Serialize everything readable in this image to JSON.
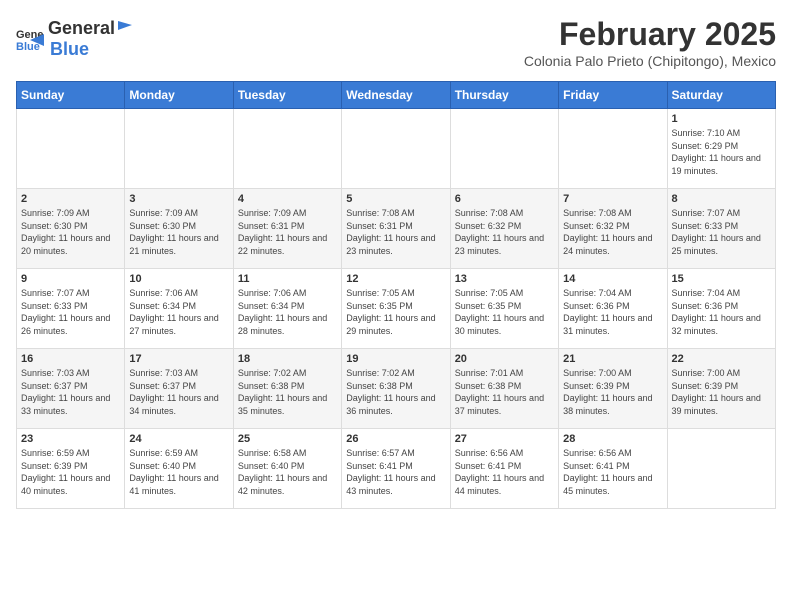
{
  "logo": {
    "general": "General",
    "blue": "Blue"
  },
  "title": "February 2025",
  "subtitle": "Colonia Palo Prieto (Chipitongo), Mexico",
  "days_of_week": [
    "Sunday",
    "Monday",
    "Tuesday",
    "Wednesday",
    "Thursday",
    "Friday",
    "Saturday"
  ],
  "weeks": [
    [
      {
        "day": "",
        "info": ""
      },
      {
        "day": "",
        "info": ""
      },
      {
        "day": "",
        "info": ""
      },
      {
        "day": "",
        "info": ""
      },
      {
        "day": "",
        "info": ""
      },
      {
        "day": "",
        "info": ""
      },
      {
        "day": "1",
        "info": "Sunrise: 7:10 AM\nSunset: 6:29 PM\nDaylight: 11 hours and 19 minutes."
      }
    ],
    [
      {
        "day": "2",
        "info": "Sunrise: 7:09 AM\nSunset: 6:30 PM\nDaylight: 11 hours and 20 minutes."
      },
      {
        "day": "3",
        "info": "Sunrise: 7:09 AM\nSunset: 6:30 PM\nDaylight: 11 hours and 21 minutes."
      },
      {
        "day": "4",
        "info": "Sunrise: 7:09 AM\nSunset: 6:31 PM\nDaylight: 11 hours and 22 minutes."
      },
      {
        "day": "5",
        "info": "Sunrise: 7:08 AM\nSunset: 6:31 PM\nDaylight: 11 hours and 23 minutes."
      },
      {
        "day": "6",
        "info": "Sunrise: 7:08 AM\nSunset: 6:32 PM\nDaylight: 11 hours and 23 minutes."
      },
      {
        "day": "7",
        "info": "Sunrise: 7:08 AM\nSunset: 6:32 PM\nDaylight: 11 hours and 24 minutes."
      },
      {
        "day": "8",
        "info": "Sunrise: 7:07 AM\nSunset: 6:33 PM\nDaylight: 11 hours and 25 minutes."
      }
    ],
    [
      {
        "day": "9",
        "info": "Sunrise: 7:07 AM\nSunset: 6:33 PM\nDaylight: 11 hours and 26 minutes."
      },
      {
        "day": "10",
        "info": "Sunrise: 7:06 AM\nSunset: 6:34 PM\nDaylight: 11 hours and 27 minutes."
      },
      {
        "day": "11",
        "info": "Sunrise: 7:06 AM\nSunset: 6:34 PM\nDaylight: 11 hours and 28 minutes."
      },
      {
        "day": "12",
        "info": "Sunrise: 7:05 AM\nSunset: 6:35 PM\nDaylight: 11 hours and 29 minutes."
      },
      {
        "day": "13",
        "info": "Sunrise: 7:05 AM\nSunset: 6:35 PM\nDaylight: 11 hours and 30 minutes."
      },
      {
        "day": "14",
        "info": "Sunrise: 7:04 AM\nSunset: 6:36 PM\nDaylight: 11 hours and 31 minutes."
      },
      {
        "day": "15",
        "info": "Sunrise: 7:04 AM\nSunset: 6:36 PM\nDaylight: 11 hours and 32 minutes."
      }
    ],
    [
      {
        "day": "16",
        "info": "Sunrise: 7:03 AM\nSunset: 6:37 PM\nDaylight: 11 hours and 33 minutes."
      },
      {
        "day": "17",
        "info": "Sunrise: 7:03 AM\nSunset: 6:37 PM\nDaylight: 11 hours and 34 minutes."
      },
      {
        "day": "18",
        "info": "Sunrise: 7:02 AM\nSunset: 6:38 PM\nDaylight: 11 hours and 35 minutes."
      },
      {
        "day": "19",
        "info": "Sunrise: 7:02 AM\nSunset: 6:38 PM\nDaylight: 11 hours and 36 minutes."
      },
      {
        "day": "20",
        "info": "Sunrise: 7:01 AM\nSunset: 6:38 PM\nDaylight: 11 hours and 37 minutes."
      },
      {
        "day": "21",
        "info": "Sunrise: 7:00 AM\nSunset: 6:39 PM\nDaylight: 11 hours and 38 minutes."
      },
      {
        "day": "22",
        "info": "Sunrise: 7:00 AM\nSunset: 6:39 PM\nDaylight: 11 hours and 39 minutes."
      }
    ],
    [
      {
        "day": "23",
        "info": "Sunrise: 6:59 AM\nSunset: 6:39 PM\nDaylight: 11 hours and 40 minutes."
      },
      {
        "day": "24",
        "info": "Sunrise: 6:59 AM\nSunset: 6:40 PM\nDaylight: 11 hours and 41 minutes."
      },
      {
        "day": "25",
        "info": "Sunrise: 6:58 AM\nSunset: 6:40 PM\nDaylight: 11 hours and 42 minutes."
      },
      {
        "day": "26",
        "info": "Sunrise: 6:57 AM\nSunset: 6:41 PM\nDaylight: 11 hours and 43 minutes."
      },
      {
        "day": "27",
        "info": "Sunrise: 6:56 AM\nSunset: 6:41 PM\nDaylight: 11 hours and 44 minutes."
      },
      {
        "day": "28",
        "info": "Sunrise: 6:56 AM\nSunset: 6:41 PM\nDaylight: 11 hours and 45 minutes."
      },
      {
        "day": "",
        "info": ""
      }
    ]
  ]
}
